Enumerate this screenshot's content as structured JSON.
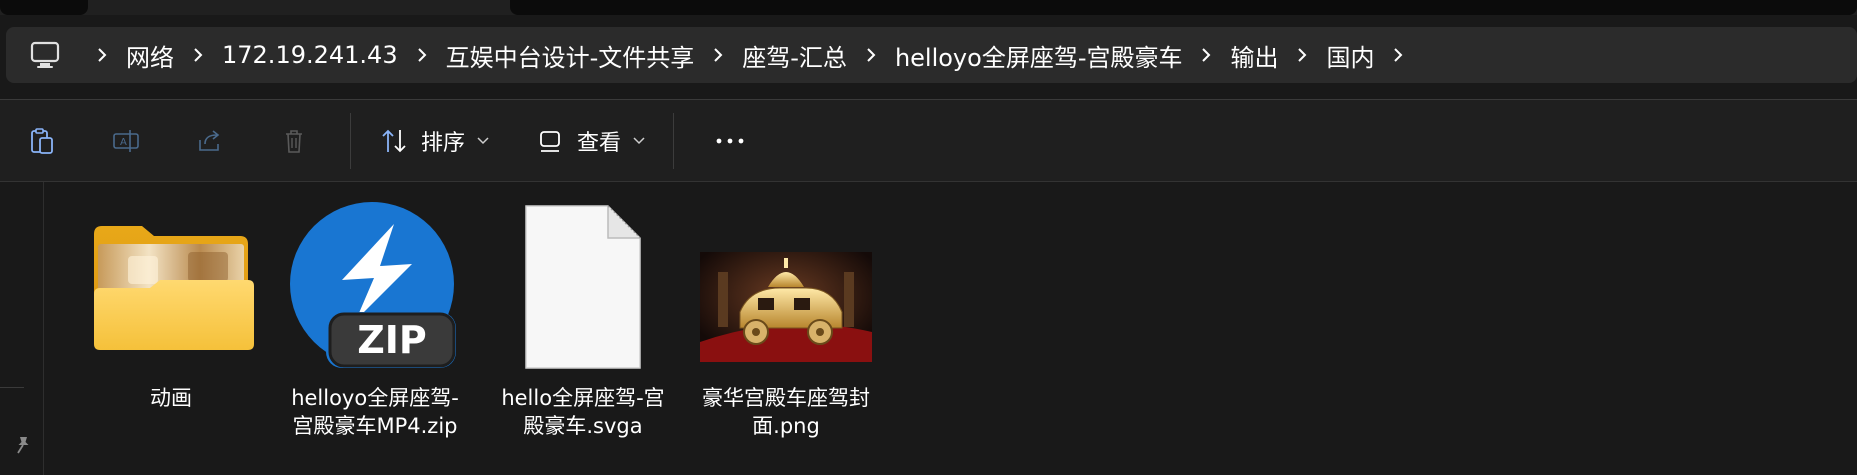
{
  "breadcrumb": {
    "root_icon": "this-pc-icon",
    "items": [
      "网络",
      "172.19.241.43",
      "互娱中台设计-文件共享",
      "座驾-汇总",
      "helloyo全屏座驾-宫殿豪车",
      "输出",
      "国内"
    ]
  },
  "toolbar": {
    "icons": [
      "paste-icon",
      "rename-icon",
      "share-icon",
      "delete-icon"
    ],
    "sort_label": "排序",
    "view_label": "查看",
    "more_icon": "more-dots-icon"
  },
  "files": [
    {
      "name_line1": "动画",
      "name_line2": "",
      "type_icon": "folder-icon"
    },
    {
      "name_line1": "helloyo全屏座驾-",
      "name_line2": "宫殿豪车MP4.zip",
      "type_icon": "zip-archive-icon",
      "badge": "ZIP"
    },
    {
      "name_line1": "hello全屏座驾-宫",
      "name_line2": "殿豪车.svga",
      "type_icon": "blank-file-icon"
    },
    {
      "name_line1": "豪华宫殿车座驾封",
      "name_line2": "面.png",
      "type_icon": "image-thumbnail"
    }
  ],
  "colors": {
    "background": "#191919",
    "toolbar": "#1f1f1f",
    "address_bar": "#2b2b2b",
    "zip_blue": "#1976d2",
    "folder_yellow": "#f7c948"
  }
}
